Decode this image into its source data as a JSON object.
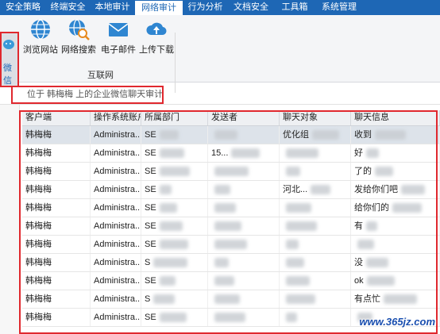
{
  "tabs": [
    {
      "label": "安全策略"
    },
    {
      "label": "终端安全"
    },
    {
      "label": "本地审计"
    },
    {
      "label": "网络审计",
      "active": true
    },
    {
      "label": "行为分析"
    },
    {
      "label": "文档安全"
    },
    {
      "label": "工具箱"
    },
    {
      "label": "系统管理"
    }
  ],
  "ribbon": {
    "first_button_label": "微信",
    "buttons": [
      {
        "label": "浏览网站",
        "icon": "globe-icon"
      },
      {
        "label": "网络搜索",
        "icon": "search-globe-icon"
      },
      {
        "label": "电子邮件",
        "icon": "mail-icon"
      },
      {
        "label": "上传下载",
        "icon": "cloud-upload-icon"
      }
    ],
    "group_label": "互联网"
  },
  "breadcrumb": "位于 韩梅梅 上的企业微信聊天审计",
  "table": {
    "columns": [
      "客户端",
      "操作系统账户",
      "所属部门",
      "发送者",
      "聊天对象",
      "聊天信息"
    ],
    "rows": [
      {
        "client": "韩梅梅",
        "account": "Administra...",
        "dept": "SE",
        "sender": "",
        "chat": "优化组",
        "msg": "收到"
      },
      {
        "client": "韩梅梅",
        "account": "Administra...",
        "dept": "SE",
        "sender": "15...",
        "chat": "",
        "msg": "好"
      },
      {
        "client": "韩梅梅",
        "account": "Administra...",
        "dept": "SE",
        "sender": "",
        "chat": "",
        "msg": "了的"
      },
      {
        "client": "韩梅梅",
        "account": "Administra...",
        "dept": "SE",
        "sender": "",
        "chat": "河北...",
        "msg": "发给你们吧"
      },
      {
        "client": "韩梅梅",
        "account": "Administra...",
        "dept": "SE",
        "sender": "",
        "chat": "",
        "msg": "给你们的"
      },
      {
        "client": "韩梅梅",
        "account": "Administra...",
        "dept": "SE",
        "sender": "",
        "chat": "",
        "msg": "有"
      },
      {
        "client": "韩梅梅",
        "account": "Administra...",
        "dept": "SE",
        "sender": "",
        "chat": "",
        "msg": ""
      },
      {
        "client": "韩梅梅",
        "account": "Administra...",
        "dept": "S",
        "sender": "",
        "chat": "",
        "msg": "没"
      },
      {
        "client": "韩梅梅",
        "account": "Administra...",
        "dept": "SE",
        "sender": "",
        "chat": "",
        "msg": "ok"
      },
      {
        "client": "韩梅梅",
        "account": "Administra...",
        "dept": "S",
        "sender": "",
        "chat": "",
        "msg": "有点忙"
      },
      {
        "client": "韩梅梅",
        "account": "Administra...",
        "dept": "SE",
        "sender": "",
        "chat": "",
        "msg": ""
      }
    ]
  },
  "watermark": "www.365jz.com",
  "colors": {
    "accent": "#1e67b5",
    "highlight": "#e0282e"
  }
}
